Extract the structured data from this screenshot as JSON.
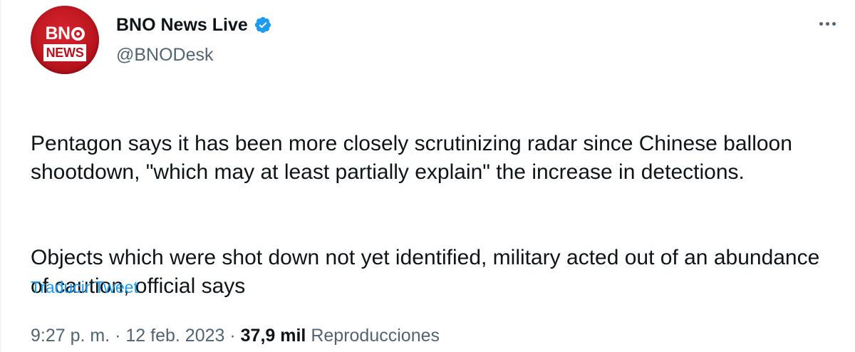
{
  "author": {
    "display_name": "BNO News Live",
    "handle": "@BNODesk",
    "verified": true,
    "avatar": {
      "logo_top": "BN",
      "logo_bottom": "NEWS",
      "brand_color": "#b5121b"
    }
  },
  "tweet": {
    "paragraphs": [
      "Pentagon says it has been more closely scrutinizing radar since Chinese balloon shootdown, \"which may at least partially explain\" the increase in detections.",
      "Objects which were shot down not yet identified, military acted out of an abundance of caution, official says"
    ],
    "translate_label": "Traducir Tweet"
  },
  "meta": {
    "time": "9:27 p. m.",
    "separator": "·",
    "date": "12 feb. 2023",
    "views_count": "37,9 mil",
    "views_label": "Reproducciones"
  },
  "icons": {
    "verified": "verified-badge-icon",
    "more": "more-options-icon"
  },
  "colors": {
    "link": "#1d9bf0",
    "secondary_text": "#536471",
    "primary_text": "#0f1419",
    "verified": "#1d9bf0"
  }
}
